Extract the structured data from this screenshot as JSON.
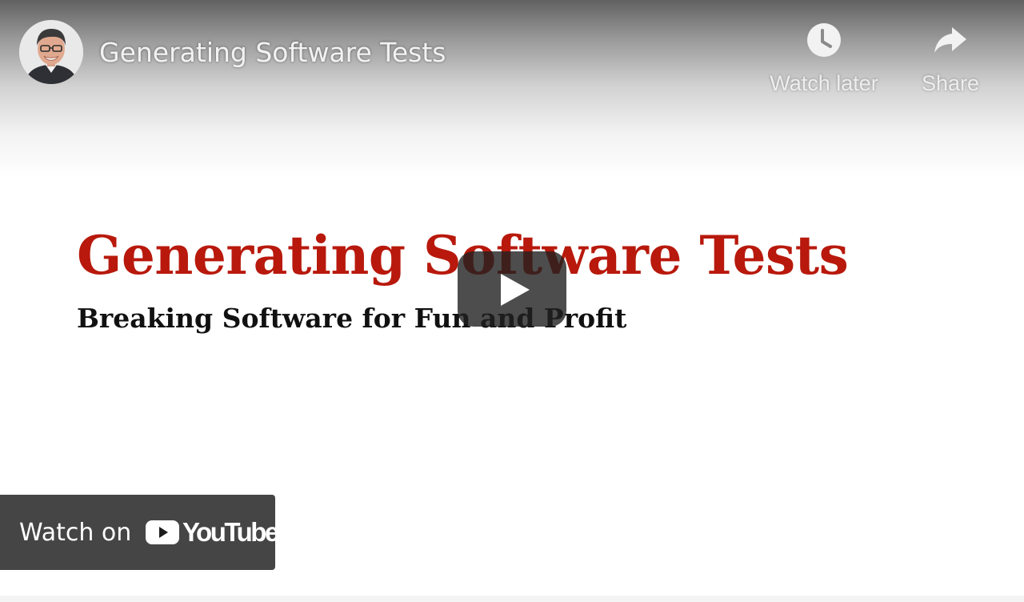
{
  "header": {
    "video_title": "Generating Software Tests",
    "channel_avatar_icon": "presenter-avatar"
  },
  "actions": {
    "watch_later_label": "Watch later",
    "watch_later_icon": "clock-icon",
    "share_label": "Share",
    "share_icon": "share-arrow-icon"
  },
  "slide": {
    "title": "Generating Software Tests",
    "subtitle": "Breaking Software for Fun and Profit",
    "title_color": "#b8190c"
  },
  "player": {
    "play_icon": "play-icon"
  },
  "watch_on": {
    "label": "Watch on",
    "brand": "YouTube",
    "brand_color": "#ff0000"
  }
}
